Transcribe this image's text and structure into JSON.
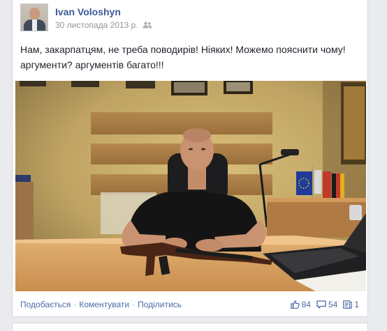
{
  "post": {
    "author": "Ivan Voloshyn",
    "date": "30 листопада 2013 р.",
    "audience_icon": "friends-icon",
    "text": "Нам, закарпатцям, не треба поводирів! Ніяких! Можемо пояснити чому! аргументи? аргументів багато!!!"
  },
  "actions": {
    "like": "Подобається",
    "comment": "Коментувати",
    "share": "Поділитись",
    "separator": "·"
  },
  "counts": {
    "likes": "84",
    "comments": "54",
    "shares": "1"
  },
  "colors": {
    "link": "#3b5998",
    "meta": "#90949c",
    "text": "#1d2129",
    "background": "#e9ebee"
  }
}
